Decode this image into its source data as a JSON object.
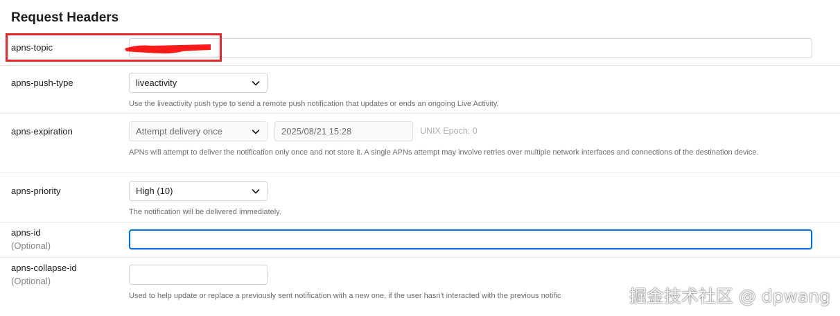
{
  "section_title": "Request Headers",
  "headers": {
    "topic": {
      "label": "apns-topic",
      "value": ""
    },
    "push_type": {
      "label": "apns-push-type",
      "selected": "liveactivity",
      "help": "Use the liveactivity push type to send a remote push notification that updates or ends an ongoing Live Activity."
    },
    "expiration": {
      "label": "apns-expiration",
      "selected": "Attempt delivery once",
      "datetime": "2025/08/21 15:28",
      "epoch": "UNIX Epoch: 0",
      "help": "APNs will attempt to deliver the notification only once and not store it. A single APNs attempt may involve retries over multiple network interfaces and connections of the destination device."
    },
    "priority": {
      "label": "apns-priority",
      "selected": "High (10)",
      "help": "The notification will be delivered immediately."
    },
    "id": {
      "label": "apns-id",
      "optional": "(Optional)",
      "value": ""
    },
    "collapse_id": {
      "label": "apns-collapse-id",
      "optional": "(Optional)",
      "value": "",
      "help": "Used to help update or replace a previously sent notification with a new one, if the user hasn't interacted with the previous notific"
    }
  },
  "watermark": "掘金技术社区 @ dpwang",
  "colors": {
    "annotation_red": "#e8262a",
    "focus_blue": "#0071e3",
    "divider": "#e6e6e6"
  }
}
